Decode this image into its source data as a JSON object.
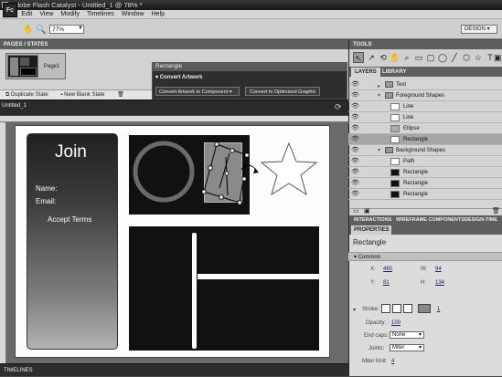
{
  "window": {
    "title": "Adobe Flash Catalyst - Untitled_1 @ 78% *"
  },
  "menu": [
    "File",
    "Edit",
    "View",
    "Modify",
    "Timelines",
    "Window",
    "Help"
  ],
  "toolbar": {
    "logo": "Fc",
    "zoom": "77%",
    "workspace": "DESIGN"
  },
  "pages": {
    "header": "PAGES / STATES",
    "page_label": "Page1",
    "duplicate_label": "Duplicate State",
    "new_blank_label": "New Blank State"
  },
  "popup": {
    "title": "Rectangle",
    "section": "Convert Artwork",
    "btn_component": "Convert Artwork to Component",
    "btn_graphic": "Convert to Optimized Graphic"
  },
  "document": {
    "tab": "Untitled_1"
  },
  "artboard": {
    "join_title": "Join",
    "name_label": "Name:",
    "email_label": "Email:",
    "accept_label": "Accept Terms"
  },
  "timelines": {
    "label": "TIMELINES"
  },
  "tools": {
    "header": "TOOLS"
  },
  "layers": {
    "tabs": [
      "LAYERS",
      "LIBRARY"
    ],
    "rows": [
      {
        "label": "Text"
      },
      {
        "label": "Foreground Shapes"
      },
      {
        "label": "Line"
      },
      {
        "label": "Line"
      },
      {
        "label": "Ellipse"
      },
      {
        "label": "Rectangle"
      },
      {
        "label": "Background Shapes"
      },
      {
        "label": "Path"
      },
      {
        "label": "Rectangle"
      },
      {
        "label": "Rectangle"
      },
      {
        "label": "Rectangle"
      }
    ]
  },
  "interactions": {
    "tabs": [
      "INTERACTIONS",
      "WIREFRAME COMPONENTS",
      "DESIGN-TIME D"
    ]
  },
  "properties": {
    "tab": "PROPERTIES",
    "title": "Rectangle",
    "common": "Common",
    "x_label": "X:",
    "x_val": "480",
    "y_label": "Y:",
    "y_val": "81",
    "w_label": "W:",
    "w_val": "94",
    "h_label": "H:",
    "h_val": "134",
    "stroke_label": "Stroke:",
    "stroke_val": "1",
    "opacity_label": "Opacity:",
    "opacity_val": "100",
    "endcaps_label": "End caps:",
    "endcaps_val": "None",
    "joints_label": "Joints:",
    "joints_val": "Miter",
    "miter_label": "Miter limit:",
    "miter_val": "4"
  }
}
